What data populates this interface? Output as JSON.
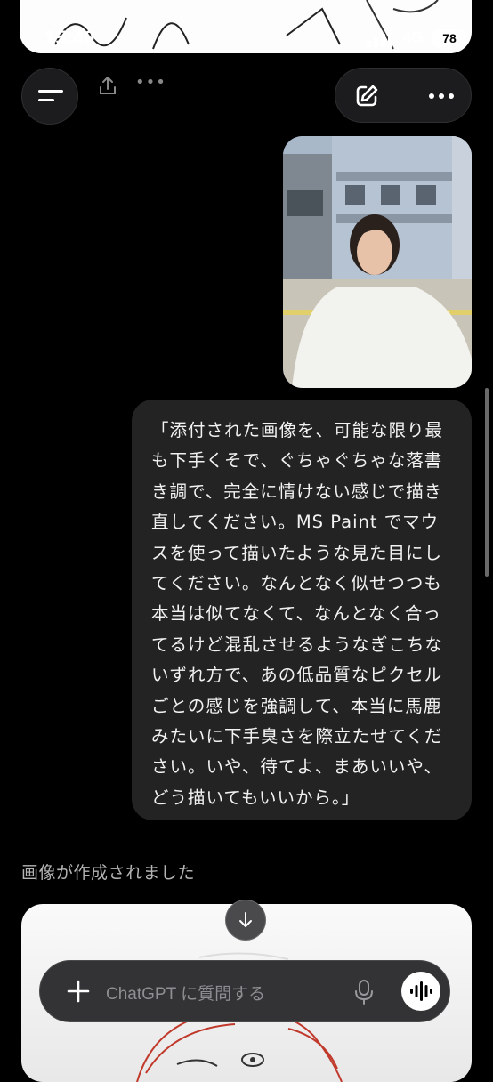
{
  "status_bar": {
    "time": "15:40",
    "network": "4G",
    "battery": "78"
  },
  "header": {
    "menu_icon": "sidebar-menu-icon",
    "share_icon": "share-icon",
    "more_icon": "more-dots-icon",
    "new_chat_icon": "new-chat-pencil-icon"
  },
  "conversation": {
    "user_message": "「添付された画像を、可能な限り最\nも下手くそで、ぐちゃぐちゃな落書\nき調で、完全に情けない感じで描き\n直してください。MS Paint でマウ\nスを使って描いたような見た目にし\nてください。なんとなく似せつつも\n本当は似てなくて、なんとなく合っ\nてるけど混乱させるようなぎこちな\nいずれ方で、あの低品質なピクセル\nごとの感じを強調して、本当に馬鹿\nみたいに下手臭さを際立たせてくだ\nさい。いや、待てよ、まあいいや、\nどう描いてもいいから。」",
    "status_label": "画像が作成されました"
  },
  "composer": {
    "placeholder": "ChatGPT に質問する",
    "plus_icon": "plus-icon",
    "mic_icon": "microphone-icon",
    "voice_icon": "voice-mode-icon"
  }
}
